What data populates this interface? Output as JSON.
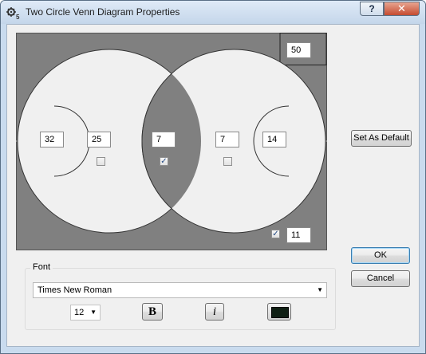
{
  "window": {
    "title": "Two Circle Venn Diagram Properties",
    "help_label": "?",
    "close_label": "✕"
  },
  "venn": {
    "outside_value": "50",
    "left_outer_value": "32",
    "left_only_value": "25",
    "intersection_value": "7",
    "right_only_value": "7",
    "right_outer_value": "14",
    "bottom_value": "11",
    "left_only_checked": false,
    "intersection_checked": true,
    "right_only_checked": false,
    "bottom_checked": true,
    "colors": {
      "background": "#808080",
      "circle_fill": "#f0f0f0",
      "intersection_fill": "#808080"
    }
  },
  "buttons": {
    "set_as_default": "Set As Default",
    "ok": "OK",
    "cancel": "Cancel"
  },
  "font": {
    "group_label": "Font",
    "family": "Times New Roman",
    "size": "12",
    "bold_label": "B",
    "italic_label": "i",
    "color": "#0f1f14"
  },
  "icons": {
    "app": "venn-settings-icon",
    "dropdown": "chevron-down-icon",
    "check": "checkmark-icon"
  }
}
